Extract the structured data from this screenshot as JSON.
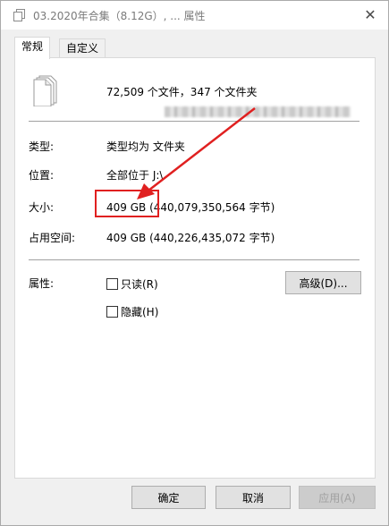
{
  "window": {
    "title": "03.2020年合集（8.12G）, ... 属性",
    "close_glyph": "✕"
  },
  "tabs": [
    {
      "label": "常规",
      "active": true
    },
    {
      "label": "自定义",
      "active": false
    }
  ],
  "general": {
    "summary": "72,509 个文件，347 个文件夹",
    "rows": {
      "type": {
        "label": "类型:",
        "value": "类型均为 文件夹"
      },
      "location": {
        "label": "位置:",
        "value": "全部位于 J:\\"
      },
      "size": {
        "label": "大小:",
        "value": "409 GB (440,079,350,564 字节)"
      },
      "size_on_disk": {
        "label": "占用空间:",
        "value": "409 GB (440,226,435,072 字节)"
      }
    },
    "attributes": {
      "label": "属性:",
      "readonly": {
        "label": "只读(R)",
        "checked": false
      },
      "hidden": {
        "label": "隐藏(H)",
        "checked": false
      },
      "advanced_button": "高级(D)..."
    }
  },
  "footer": {
    "ok": "确定",
    "cancel": "取消",
    "apply": "应用(A)"
  },
  "annotation": {
    "color": "#e02020"
  },
  "icons": {
    "title": "folder-copy-icon",
    "summary": "multiple-files-icon"
  }
}
